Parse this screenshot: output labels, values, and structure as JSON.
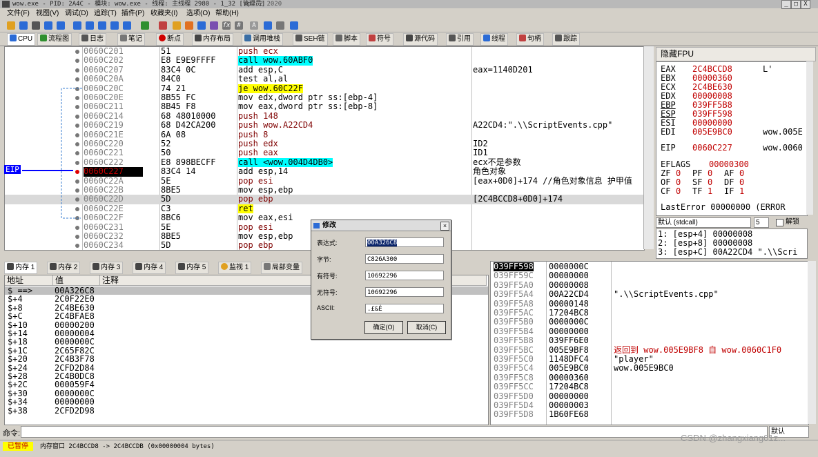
{
  "window": {
    "title": "wow.exe - PID: 2A4C - 模块: wow.exe - 线程: 主线程 2980 - 1_32 [管理员]",
    "date": "Apr 2 2020",
    "controls": [
      "_",
      "□",
      "X"
    ]
  },
  "menu": [
    "文件(F)",
    "视图(V)",
    "调试(D)",
    "追踪(T)",
    "插件(P)",
    "收藏夹(I)",
    "选项(O)",
    "帮助(H)"
  ],
  "tabs": [
    {
      "label": "CPU",
      "icon": "cpu-icon",
      "color": "#2b6bd6"
    },
    {
      "label": "流程图",
      "icon": "graph-icon",
      "color": "#2f8f2f"
    },
    {
      "label": "日志",
      "icon": "log-icon",
      "color": "#555555"
    },
    {
      "label": "笔记",
      "icon": "notes-icon",
      "color": "#777777"
    },
    {
      "label": "断点",
      "icon": "breakpoint-icon",
      "color": "#d00000"
    },
    {
      "label": "内存布局",
      "icon": "memory-map-icon",
      "color": "#444444"
    },
    {
      "label": "调用堆栈",
      "icon": "callstack-icon",
      "color": "#3a6ea5"
    },
    {
      "label": "SEH链",
      "icon": "seh-icon",
      "color": "#555555"
    },
    {
      "label": "脚本",
      "icon": "script-icon",
      "color": "#666666"
    },
    {
      "label": "符号",
      "icon": "symbols-icon",
      "color": "#c04040"
    },
    {
      "label": "源代码",
      "icon": "source-icon",
      "color": "#444444"
    },
    {
      "label": "引用",
      "icon": "references-icon",
      "color": "#555555"
    },
    {
      "label": "线程",
      "icon": "threads-icon",
      "color": "#2b6bd6"
    },
    {
      "label": "句柄",
      "icon": "handles-icon",
      "color": "#c04040"
    },
    {
      "label": "跟踪",
      "icon": "trace-icon",
      "color": "#555555"
    }
  ],
  "disasm": {
    "eip_label": "EIP",
    "rows": [
      {
        "addr": "0060C201",
        "hex": "51",
        "ins": "push ecx",
        "cmt": ""
      },
      {
        "addr": "0060C202",
        "hex": "E8 E9E9FFFF",
        "ins": "call wow.60ABF0",
        "cmt": ""
      },
      {
        "addr": "0060C207",
        "hex": "83C4 0C",
        "ins": "add esp,C",
        "cmt": "eax=1140D201"
      },
      {
        "addr": "0060C20A",
        "hex": "84C0",
        "ins": "test al,al",
        "cmt": ""
      },
      {
        "addr": "0060C20C",
        "hex": "74 21",
        "ins": "je wow.60C22F",
        "cmt": ""
      },
      {
        "addr": "0060C20E",
        "hex": "8B55 FC",
        "ins": "mov edx,dword ptr ss:[ebp-4]",
        "cmt": ""
      },
      {
        "addr": "0060C211",
        "hex": "8B45 F8",
        "ins": "mov eax,dword ptr ss:[ebp-8]",
        "cmt": ""
      },
      {
        "addr": "0060C214",
        "hex": "68 48010000",
        "ins": "push 148",
        "cmt": ""
      },
      {
        "addr": "0060C219",
        "hex": "68 D42CA200",
        "ins": "push wow.A22CD4",
        "cmt": "A22CD4:\".\\\\ScriptEvents.cpp\""
      },
      {
        "addr": "0060C21E",
        "hex": "6A 08",
        "ins": "push 8",
        "cmt": ""
      },
      {
        "addr": "0060C220",
        "hex": "52",
        "ins": "push edx",
        "cmt": "ID2"
      },
      {
        "addr": "0060C221",
        "hex": "50",
        "ins": "push eax",
        "cmt": "ID1"
      },
      {
        "addr": "0060C222",
        "hex": "E8 898BECFF",
        "ins": "call <wow.004D4DB0>",
        "cmt": "ecx不是参数"
      },
      {
        "addr": "0060C227",
        "hex": "83C4 14",
        "ins": "add esp,14",
        "cmt": "角色对象"
      },
      {
        "addr": "0060C22A",
        "hex": "5E",
        "ins": "pop esi",
        "cmt": "[eax+0D0]+174 //角色对象信息 护甲值"
      },
      {
        "addr": "0060C22B",
        "hex": "8BE5",
        "ins": "mov esp,ebp",
        "cmt": ""
      },
      {
        "addr": "0060C22D",
        "hex": "5D",
        "ins": "pop ebp",
        "cmt": "[2C4BCCD8+0D0]+174"
      },
      {
        "addr": "0060C22E",
        "hex": "C3",
        "ins": "ret",
        "cmt": ""
      },
      {
        "addr": "0060C22F",
        "hex": "8BC6",
        "ins": "mov eax,esi",
        "cmt": ""
      },
      {
        "addr": "0060C231",
        "hex": "5E",
        "ins": "pop esi",
        "cmt": ""
      },
      {
        "addr": "0060C232",
        "hex": "8BE5",
        "ins": "mov esp,ebp",
        "cmt": ""
      },
      {
        "addr": "0060C234",
        "hex": "5D",
        "ins": "pop ebp",
        "cmt": ""
      }
    ]
  },
  "registers": {
    "title": "隐藏FPU",
    "rows": [
      {
        "name": "EAX",
        "value": "2C4BCCD8",
        "note": "L'"
      },
      {
        "name": "EBX",
        "value": "00000360",
        "note": ""
      },
      {
        "name": "ECX",
        "value": "2C4BE630",
        "note": ""
      },
      {
        "name": "EDX",
        "value": "00000008",
        "note": ""
      },
      {
        "name": "EBP",
        "value": "039FF5B8",
        "note": ""
      },
      {
        "name": "ESP",
        "value": "039FF598",
        "note": ""
      },
      {
        "name": "ESI",
        "value": "00000000",
        "note": ""
      },
      {
        "name": "EDI",
        "value": "005E9BC0",
        "note": "wow.005E"
      },
      {
        "name": "EIP",
        "value": "0060C227",
        "note": "wow.0060"
      }
    ],
    "eflags_label": "EFLAGS",
    "eflags_value": "00000300",
    "flags": [
      [
        "ZF",
        "0",
        "PF",
        "0",
        "AF",
        "0"
      ],
      [
        "OF",
        "0",
        "SF",
        "0",
        "DF",
        "0"
      ],
      [
        "CF",
        "0",
        "TF",
        "1",
        "IF",
        "1"
      ]
    ],
    "last_error": "LastError  00000000 (ERROR"
  },
  "callconv": {
    "selected": "默认 (stdcall)",
    "count": "5",
    "unlock": "解锁"
  },
  "stack_args": [
    "1: [esp+4] 00000008",
    "2: [esp+8] 00000008",
    "3: [esp+C] 00A22CD4 \".\\\\Scri"
  ],
  "mem_tabs": [
    "内存 1",
    "内存 2",
    "内存 3",
    "内存 4",
    "内存 5",
    "监视 1",
    "局部变量"
  ],
  "dump": {
    "headers": [
      "地址",
      "值",
      "注释"
    ],
    "rows": [
      {
        "a": "$ ==>",
        "v": "00A326C8"
      },
      {
        "a": "$+4",
        "v": "2C0F22E0"
      },
      {
        "a": "$+8",
        "v": "2C4BE630"
      },
      {
        "a": "$+C",
        "v": "2C4BFAE8"
      },
      {
        "a": "$+10",
        "v": "00000200"
      },
      {
        "a": "$+14",
        "v": "00000004"
      },
      {
        "a": "$+18",
        "v": "0000000C"
      },
      {
        "a": "$+1C",
        "v": "2C65F82C"
      },
      {
        "a": "$+20",
        "v": "2C4B3F78"
      },
      {
        "a": "$+24",
        "v": "2CFD2D84"
      },
      {
        "a": "$+28",
        "v": "2C4B0DC8"
      },
      {
        "a": "$+2C",
        "v": "000059F4"
      },
      {
        "a": "$+30",
        "v": "0000000C"
      },
      {
        "a": "$+34",
        "v": "00000000"
      },
      {
        "a": "$+38",
        "v": "2CFD2D98"
      }
    ]
  },
  "stack": {
    "rows": [
      {
        "a": "039FF598",
        "v": "0000000C",
        "c": ""
      },
      {
        "a": "039FF59C",
        "v": "00000000",
        "c": ""
      },
      {
        "a": "039FF5A0",
        "v": "00000008",
        "c": ""
      },
      {
        "a": "039FF5A4",
        "v": "00A22CD4",
        "c": "\".\\\\ScriptEvents.cpp\""
      },
      {
        "a": "039FF5A8",
        "v": "00000148",
        "c": ""
      },
      {
        "a": "039FF5AC",
        "v": "17204BC8",
        "c": ""
      },
      {
        "a": "039FF5B0",
        "v": "0000000C",
        "c": ""
      },
      {
        "a": "039FF5B4",
        "v": "00000000",
        "c": ""
      },
      {
        "a": "039FF5B8",
        "v": "039FF6E0",
        "c": ""
      },
      {
        "a": "039FF5BC",
        "v": "005E9BF8",
        "c": "返回到 wow.005E9BF8 自 wow.0060C1F0"
      },
      {
        "a": "039FF5C0",
        "v": "1148DFC4",
        "c": "\"player\""
      },
      {
        "a": "039FF5C4",
        "v": "005E9BC0",
        "c": "wow.005E9BC0"
      },
      {
        "a": "039FF5C8",
        "v": "00000360",
        "c": ""
      },
      {
        "a": "039FF5CC",
        "v": "17204BC8",
        "c": ""
      },
      {
        "a": "039FF5D0",
        "v": "00000000",
        "c": ""
      },
      {
        "a": "039FF5D4",
        "v": "00000003",
        "c": ""
      },
      {
        "a": "039FF5D8",
        "v": "1B60FE68",
        "c": ""
      }
    ]
  },
  "dialog": {
    "title": "修改",
    "fields": [
      {
        "label": "表达式:",
        "value": "00A326C8"
      },
      {
        "label": "字节:",
        "value": "C826A300"
      },
      {
        "label": "有符号:",
        "value": "10692296"
      },
      {
        "label": "无符号:",
        "value": "10692296"
      },
      {
        "label": "ASCII:",
        "value": ".£&É"
      }
    ],
    "ok": "确定(O)",
    "cancel": "取消(C)"
  },
  "command": {
    "label": "命令:",
    "mode": "默认"
  },
  "status": {
    "paused": "已暂停",
    "text": "内存窗口  2C4BCCD8 -> 2C4BCCDB (0x00000004 bytes)",
    "watermark": "CSDN @zhangxiang01z..."
  }
}
